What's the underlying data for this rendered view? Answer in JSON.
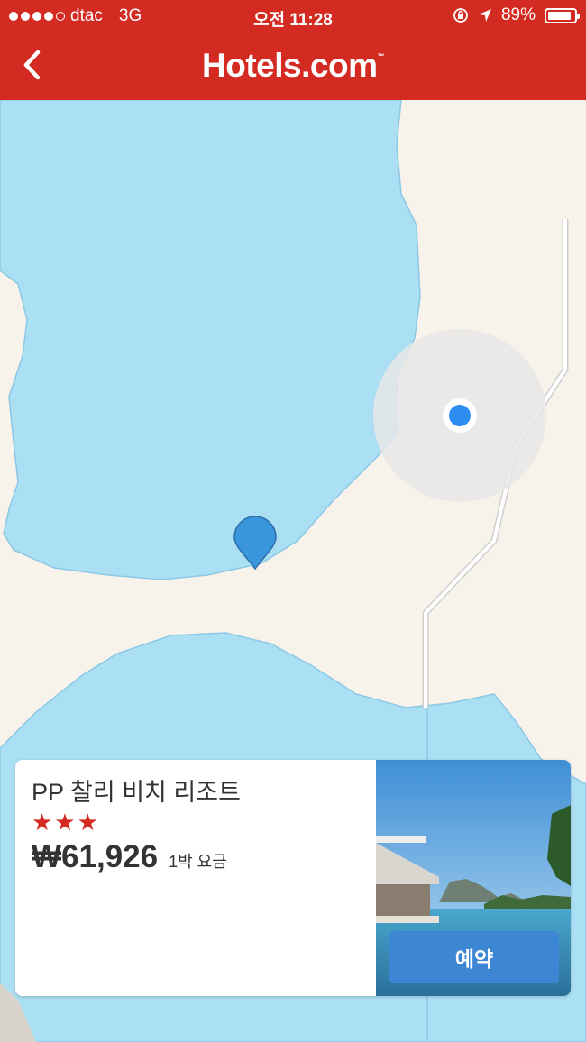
{
  "status": {
    "carrier": "dtac",
    "network": "3G",
    "time": "오전 11:28",
    "battery": "89%",
    "battery_level": 0.89
  },
  "header": {
    "brand": "Hotels.com",
    "trademark": "™",
    "accent_color": "#d32a22"
  },
  "map": {
    "water_color": "#abdff3",
    "land_color": "#f7f2ea"
  },
  "hotel": {
    "name": "PP 찰리 비치 리조트",
    "stars": "★★★",
    "star_rating": 3,
    "price": "₩61,926",
    "price_note": "1박 요금",
    "book_label": "예약",
    "button_color": "#3c86d3"
  }
}
